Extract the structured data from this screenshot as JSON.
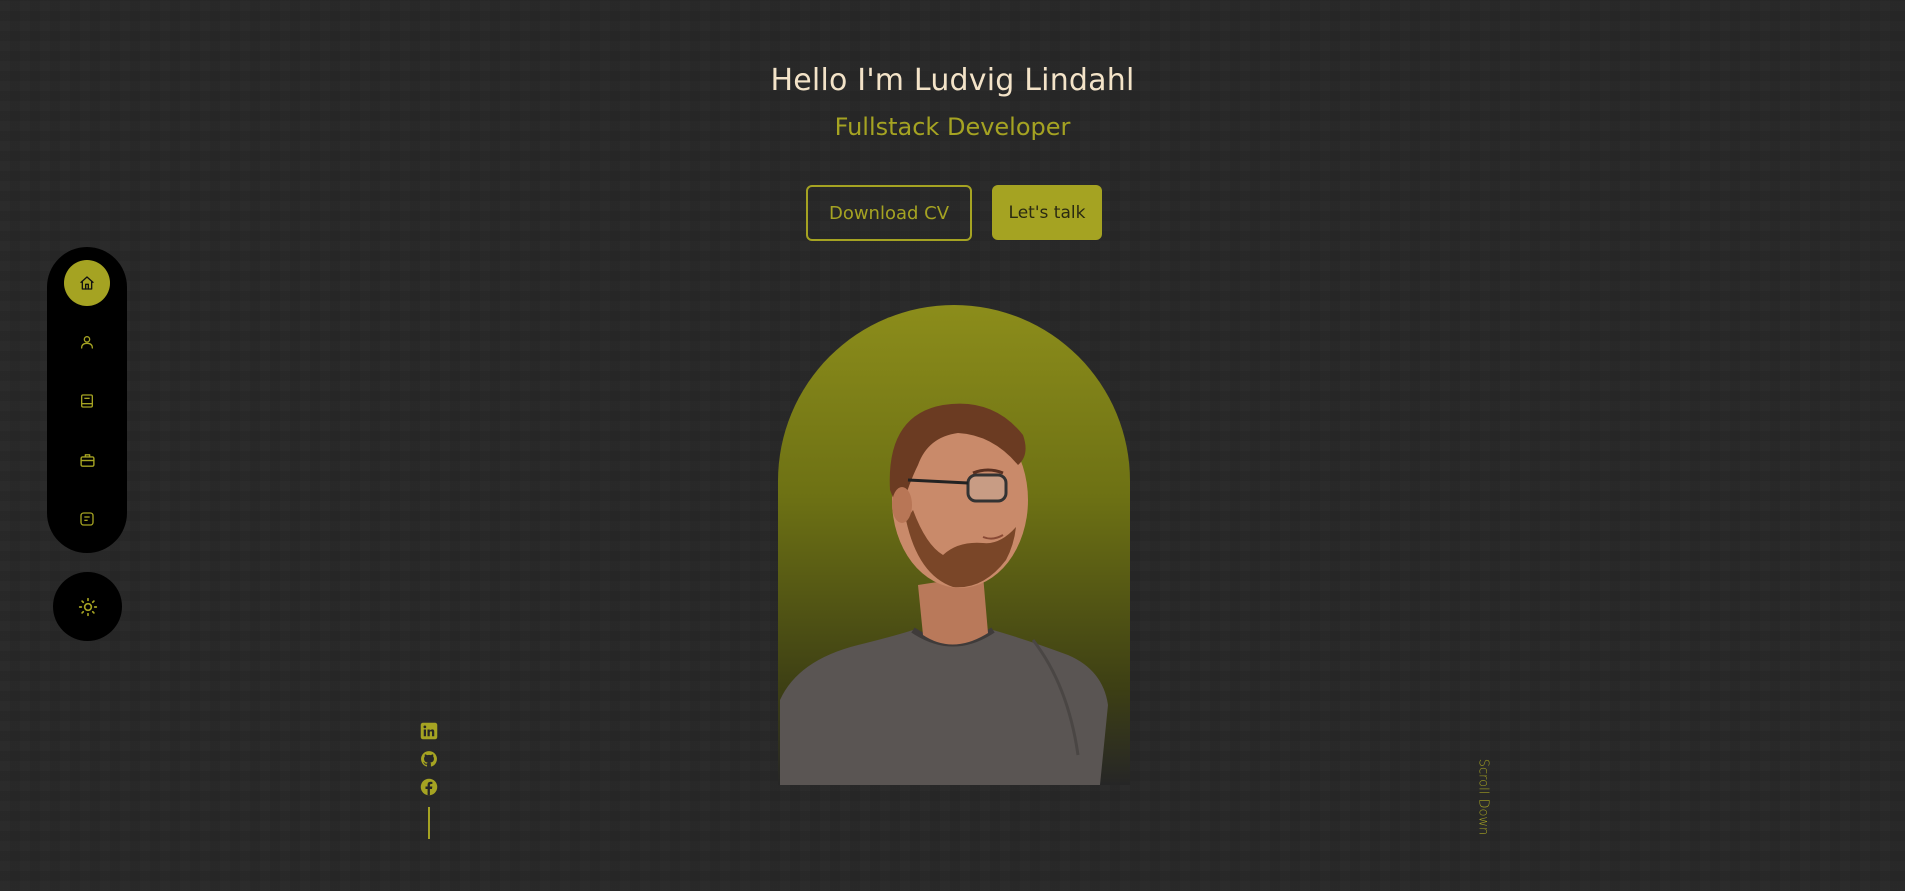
{
  "hero": {
    "greeting": "Hello I'm Ludvig Lindahl",
    "role": "Fullstack Developer",
    "download_cv_label": "Download CV",
    "lets_talk_label": "Let's talk",
    "portrait_alt": "Ludvig Lindahl portrait"
  },
  "sidebar": {
    "items": [
      {
        "id": "home",
        "icon": "home-icon",
        "active": true
      },
      {
        "id": "about",
        "icon": "user-icon",
        "active": false
      },
      {
        "id": "experience",
        "icon": "book-icon",
        "active": false
      },
      {
        "id": "portfolio",
        "icon": "briefcase-icon",
        "active": false
      },
      {
        "id": "contact",
        "icon": "message-icon",
        "active": false
      }
    ],
    "theme_toggle_icon": "sun-icon"
  },
  "socials": [
    "linkedin-icon",
    "github-icon",
    "facebook-icon"
  ],
  "scroll_down_label": "Scroll Down",
  "colors": {
    "accent": "#a5a322",
    "background": "#262626",
    "heading": "#f3e3c8",
    "sidebar": "#000000"
  }
}
